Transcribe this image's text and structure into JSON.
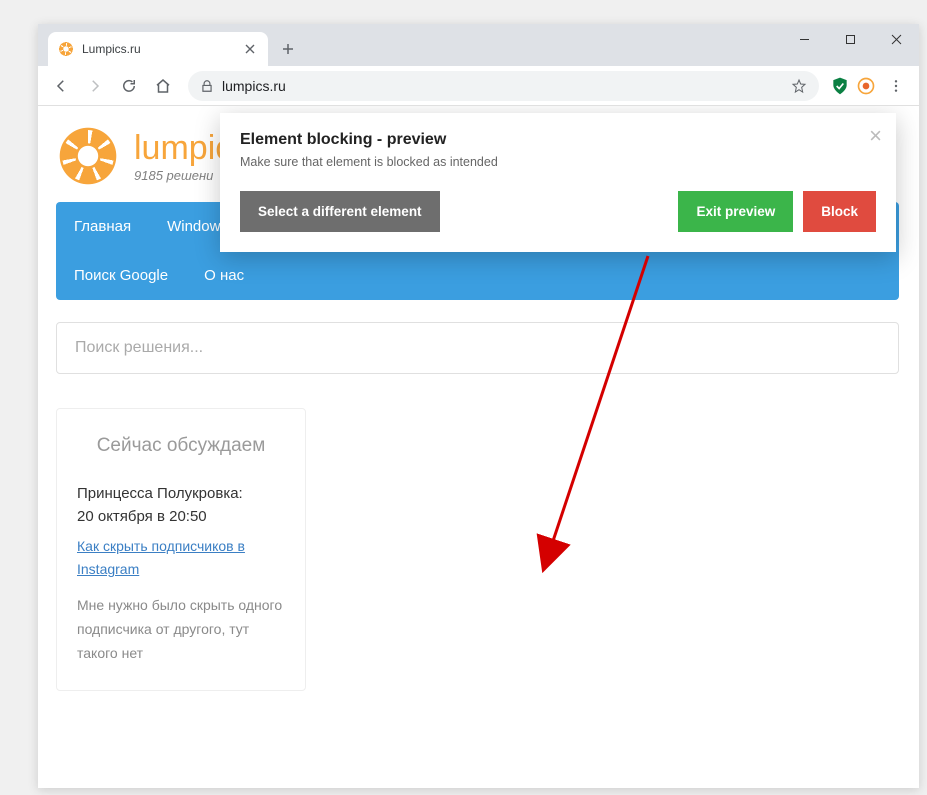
{
  "browser": {
    "tab_title": "Lumpics.ru",
    "address": "lumpics.ru"
  },
  "site": {
    "title": "lumpics.ru",
    "subtitle": "9185 решени",
    "nav_row1": [
      "Главная",
      "Window"
    ],
    "nav_row2": [
      "Поиск Google",
      "О нас"
    ],
    "search_placeholder": "Поиск решения..."
  },
  "sidebar": {
    "heading": "Сейчас обсуждаем",
    "comment": {
      "author": "Принцесса Полукровка:",
      "date": "20 октября в 20:50",
      "link": "Как скрыть подписчиков в Instagram",
      "body": "Мне нужно было скрыть одного подписчика от другого, тут такого нет"
    }
  },
  "overlay": {
    "title": "Element blocking - preview",
    "subtitle": "Make sure that element is blocked as intended",
    "select_btn": "Select a different element",
    "exit_btn": "Exit preview",
    "block_btn": "Block"
  }
}
